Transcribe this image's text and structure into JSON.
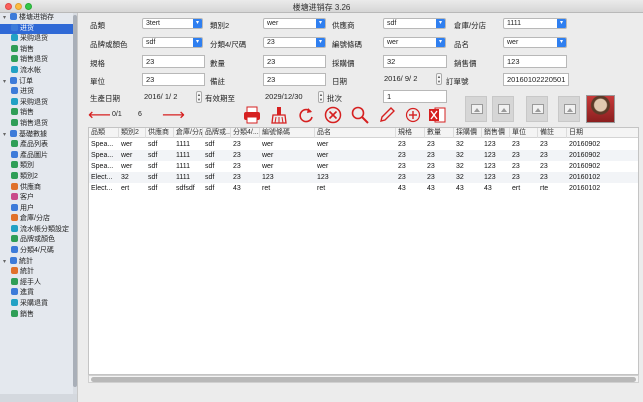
{
  "window": {
    "title": "楼塘进销存 3.26"
  },
  "sidebar": {
    "items": [
      {
        "label": "楼塘进销存",
        "kind": "group",
        "icon": "app-icon",
        "color": "#3d7bd9"
      },
      {
        "label": "进货",
        "kind": "child",
        "icon": "inbound-icon",
        "color": "#3d7bd9",
        "selected": true
      },
      {
        "label": "采购退货",
        "kind": "child",
        "icon": "return-icon",
        "color": "#22a1c4"
      },
      {
        "label": "销售",
        "kind": "child",
        "icon": "sales-icon",
        "color": "#2f9e57"
      },
      {
        "label": "销售退货",
        "kind": "child",
        "icon": "sales-return-icon",
        "color": "#2f9e57"
      },
      {
        "label": "流水帐",
        "kind": "child",
        "icon": "ledger-icon",
        "color": "#22a1c4"
      },
      {
        "label": "订单",
        "kind": "group",
        "icon": "order-icon",
        "color": "#3d7bd9"
      },
      {
        "label": "进货",
        "kind": "child",
        "icon": "inbound-icon",
        "color": "#3d7bd9"
      },
      {
        "label": "采购退货",
        "kind": "child",
        "icon": "return-icon",
        "color": "#22a1c4"
      },
      {
        "label": "销售",
        "kind": "child",
        "icon": "sales-icon",
        "color": "#2f9e57"
      },
      {
        "label": "销售退货",
        "kind": "child",
        "icon": "sales-return-icon",
        "color": "#2f9e57"
      },
      {
        "label": "基礎數據",
        "kind": "group",
        "icon": "database-icon",
        "color": "#3d7bd9"
      },
      {
        "label": "產品列表",
        "kind": "child",
        "icon": "product-list-icon",
        "color": "#2f9e57"
      },
      {
        "label": "產品圖片",
        "kind": "child",
        "icon": "product-image-icon",
        "color": "#3d7bd9"
      },
      {
        "label": "類別",
        "kind": "child",
        "icon": "category-icon",
        "color": "#2f9e57"
      },
      {
        "label": "類別2",
        "kind": "child",
        "icon": "category-icon",
        "color": "#2f9e57"
      },
      {
        "label": "供應商",
        "kind": "child",
        "icon": "supplier-icon",
        "color": "#e0712b"
      },
      {
        "label": "客户",
        "kind": "child",
        "icon": "customer-icon",
        "color": "#c94a8a"
      },
      {
        "label": "用户",
        "kind": "child",
        "icon": "user-icon",
        "color": "#3d7bd9"
      },
      {
        "label": "倉庫/分店",
        "kind": "child",
        "icon": "warehouse-icon",
        "color": "#e0712b"
      },
      {
        "label": "流水帳分類設定",
        "kind": "child",
        "icon": "settings-icon",
        "color": "#22a1c4"
      },
      {
        "label": "品牌或顏色",
        "kind": "child",
        "icon": "brand-icon",
        "color": "#2f9e57"
      },
      {
        "label": "分類4/尺碼",
        "kind": "child",
        "icon": "size-icon",
        "color": "#3d7bd9"
      },
      {
        "label": "統計",
        "kind": "group",
        "icon": "stats-icon",
        "color": "#3d7bd9"
      },
      {
        "label": "統計",
        "kind": "child",
        "icon": "stats-icon",
        "color": "#e0712b"
      },
      {
        "label": "經手人",
        "kind": "child",
        "icon": "handler-icon",
        "color": "#2f9e57"
      },
      {
        "label": "進貨",
        "kind": "child",
        "icon": "inbound-icon",
        "color": "#3d7bd9"
      },
      {
        "label": "采購退貨",
        "kind": "child",
        "icon": "return-icon",
        "color": "#22a1c4"
      },
      {
        "label": "銷售",
        "kind": "child",
        "icon": "sales-icon",
        "color": "#2f9e57"
      }
    ]
  },
  "form": {
    "labels": {
      "category": "品類",
      "category2": "類別2",
      "supplier": "供應商",
      "warehouse": "倉庫/分店",
      "brand": "品牌或顏色",
      "size": "分類4/尺碼",
      "code": "編號條碼",
      "name": "品名",
      "spec": "規格",
      "qty": "數量",
      "cost": "採購價",
      "price": "銷售價",
      "unit": "單位",
      "note": "備註",
      "date": "日期",
      "order": "訂單號",
      "mfg_date": "生產日期",
      "expiry": "有效期至",
      "batch": "批次"
    },
    "combos": {
      "category": "3tert",
      "category2": "wer",
      "supplier": "sdf",
      "warehouse": "1111",
      "brand": "sdf",
      "size": "23",
      "code": "wer",
      "name": "wer"
    },
    "fields": {
      "spec": "23",
      "qty": "23",
      "cost": "32",
      "price": "123",
      "unit": "23",
      "note": "23",
      "order": "20160102220501",
      "batch": "1"
    },
    "dates": {
      "date": "2016/ 9/ 2",
      "mfg_date": "2016/ 1/ 2",
      "expiry": "2029/12/30"
    }
  },
  "toolbar": {
    "prev_icon": "arrow-left-icon",
    "next_icon": "arrow-right-icon",
    "page_text": "0/1",
    "count_text": "6",
    "actions": [
      "print-icon",
      "clear-icon",
      "refresh-icon",
      "delete-icon",
      "search-icon",
      "edit-icon",
      "add-icon",
      "excel-icon"
    ]
  },
  "table": {
    "columns": [
      "品類",
      "類別2",
      "供應商",
      "倉庫/分店",
      "品牌或...",
      "分類4/...",
      "編號條碼",
      "品名",
      "規格",
      "數量",
      "採購價",
      "銷售價",
      "單位",
      "備註",
      "日期"
    ],
    "rows": [
      [
        "Spea...",
        "wer",
        "sdf",
        "1111",
        "sdf",
        "23",
        "wer",
        "wer",
        "23",
        "23",
        "32",
        "123",
        "23",
        "23",
        "20160902"
      ],
      [
        "Spea...",
        "wer",
        "sdf",
        "1111",
        "sdf",
        "23",
        "wer",
        "wer",
        "23",
        "23",
        "32",
        "123",
        "23",
        "23",
        "20160902"
      ],
      [
        "Spea...",
        "wer",
        "sdf",
        "1111",
        "sdf",
        "23",
        "wer",
        "wer",
        "23",
        "23",
        "32",
        "123",
        "23",
        "23",
        "20160902"
      ],
      [
        "Elect...",
        "32",
        "sdf",
        "1111",
        "sdf",
        "23",
        "123",
        "123",
        "23",
        "23",
        "32",
        "123",
        "23",
        "23",
        "20160102"
      ],
      [
        "Elect...",
        "ert",
        "sdf",
        "sdfsdf",
        "sdf",
        "43",
        "ret",
        "ret",
        "43",
        "43",
        "43",
        "43",
        "ert",
        "rte",
        "20160102"
      ]
    ]
  }
}
